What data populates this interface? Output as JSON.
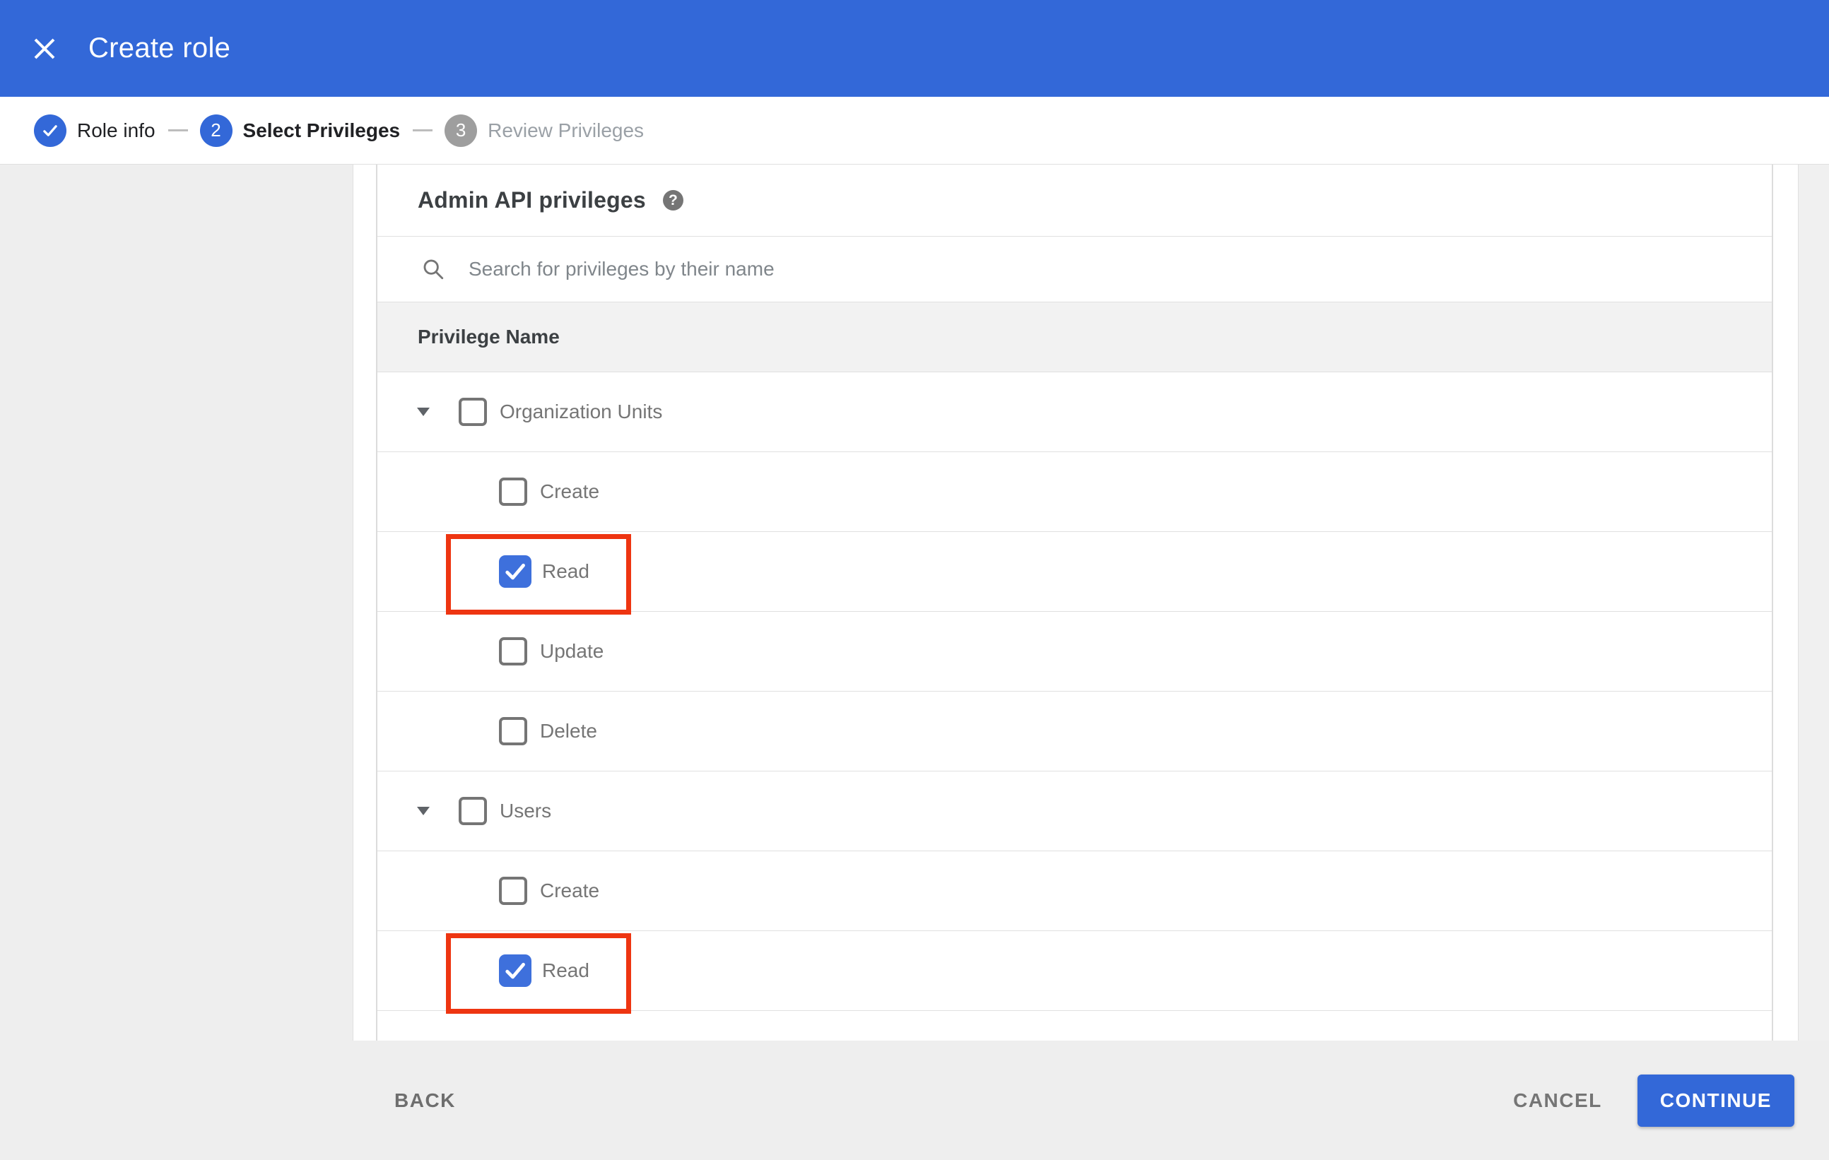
{
  "window": {
    "title": "Create role"
  },
  "stepper": {
    "steps": [
      {
        "number": "1",
        "label": "Role info",
        "state": "complete"
      },
      {
        "number": "2",
        "label": "Select Privileges",
        "state": "active"
      },
      {
        "number": "3",
        "label": "Review Privileges",
        "state": "upcoming"
      }
    ]
  },
  "privileges": {
    "heading": "Admin API privileges",
    "search": {
      "placeholder": "Search for privileges by their name"
    },
    "column_header": "Privilege Name",
    "rows": [
      {
        "type": "parent",
        "label": "Organization Units",
        "checked": false,
        "expanded": true,
        "annotated": false
      },
      {
        "type": "child",
        "label": "Create",
        "checked": false,
        "annotated": false
      },
      {
        "type": "child",
        "label": "Read",
        "checked": true,
        "annotated": true
      },
      {
        "type": "child",
        "label": "Update",
        "checked": false,
        "annotated": false
      },
      {
        "type": "child",
        "label": "Delete",
        "checked": false,
        "annotated": false
      },
      {
        "type": "parent",
        "label": "Users",
        "checked": false,
        "expanded": true,
        "annotated": false
      },
      {
        "type": "child",
        "label": "Create",
        "checked": false,
        "annotated": false
      },
      {
        "type": "child",
        "label": "Read",
        "checked": true,
        "annotated": true
      }
    ]
  },
  "footer": {
    "back_label": "BACK",
    "cancel_label": "CANCEL",
    "continue_label": "CONTINUE"
  },
  "icons": {
    "close": "close-icon",
    "step_complete": "check-icon",
    "help": "help-circle-icon",
    "search": "search-icon",
    "expander": "collapse-arrow-icon",
    "checkbox_check": "check-icon"
  },
  "colors": {
    "primary_blue": "#3368d8",
    "checkbox_blue": "#3e70dc",
    "annotation_red": "#ee3511",
    "inactive_gray": "#9e9e9e",
    "row_border": "#e0e0e0",
    "table_header_bg": "#f2f2f2",
    "footer_bg": "#eeeeee",
    "label_gray": "#757575"
  }
}
